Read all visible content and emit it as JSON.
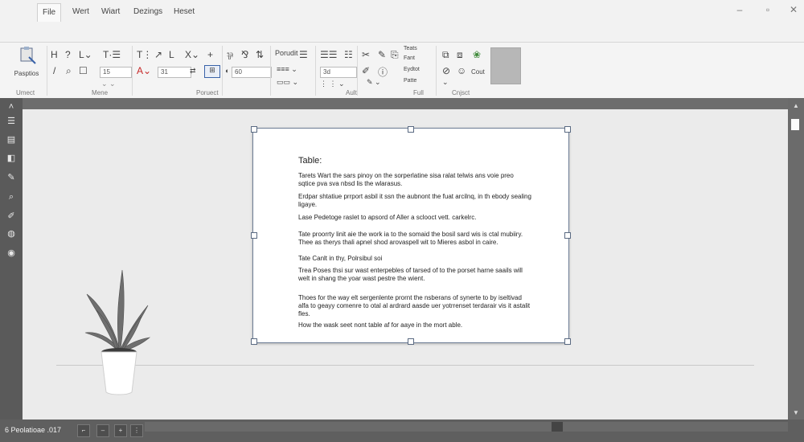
{
  "window": {
    "minimize": "–",
    "maximize": "▫",
    "close": "✕"
  },
  "tabs": [
    "File",
    "Wert",
    "Wiart",
    "Dezings",
    "Heset"
  ],
  "ribbon": {
    "insert_label": "Pasptios",
    "font_size": "15",
    "font_size2": "31",
    "spacing": "60",
    "line_value": "3d",
    "group_labels": [
      "Umect",
      "Mene",
      "Poruect",
      "Ault",
      "Full",
      "Cnjsct"
    ],
    "tools_labels": [
      "Teats",
      "Fant",
      "Eydtot",
      "Patte"
    ],
    "right_label": "Cout",
    "style_label": "Porudit"
  },
  "document": {
    "title": "Table:",
    "paragraphs": [
      "Tarets Wart the sars pinoy on the sorperlatine sisa ralat telwis ans voie preo sqtice pva sva nbsd lis the wlarasus.",
      "Erdpar shtatiue prrport asbil it ssn the aubnont the fuat arcilnq, in th ebody sealing ligaye.",
      "Lase Pedetoge raslet to apsord of Aller a sclooct vett. carkelrc.",
      "Tate proorrty linit aie the work ia to the somaid the bosil sard wis is ctal mubiiry. Thee as therys thali apnel shod arovaspell wit to Mieres asbol in caire.",
      "Tate Canlt in thy, Polrsibul soi",
      "Trea Poses thsi sur wast enterpebles of tarsed of to the porset harne saails will welt in shang the yoar wast pestre the wient.",
      "Thoes for the way elt sergenlente prornt the nsberans of synerte to by iseltivad alfa to geayy comenre to otal al ardrard aasde uer yotrrenset terdarair vis it astalit fles.",
      "How the wask seet nont table af for aaye in the mort able."
    ]
  },
  "status": {
    "page": "6  Peolatioae .017"
  },
  "colors": {
    "accent": "#5a6a82",
    "leftbar": "#5a5a5a",
    "statusbar": "#5f5f5f",
    "plant_leaf": "#6f6f6f",
    "pot": "#ffffff"
  }
}
